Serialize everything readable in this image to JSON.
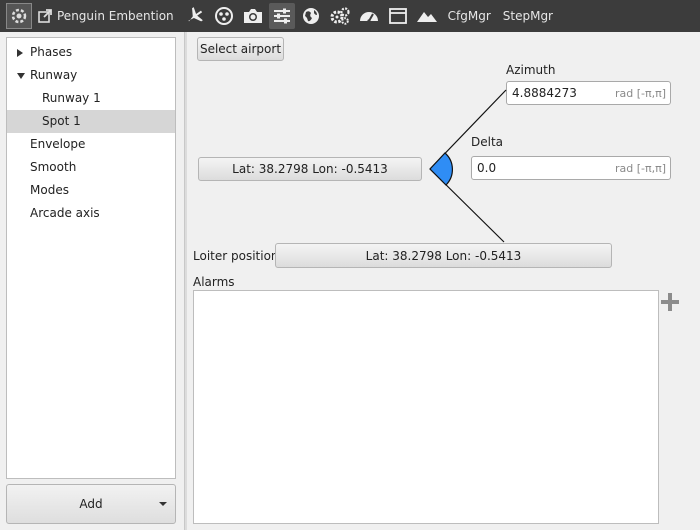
{
  "toolbar": {
    "app_title": "Penguin Embention",
    "cfgmgr_label": "CfgMgr",
    "stepmgr_label": "StepMgr"
  },
  "sidebar": {
    "items": [
      {
        "label": "Phases"
      },
      {
        "label": "Runway"
      },
      {
        "label": "Runway 1"
      },
      {
        "label": "Spot 1"
      },
      {
        "label": "Envelope"
      },
      {
        "label": "Smooth"
      },
      {
        "label": "Modes"
      },
      {
        "label": "Arcade axis"
      }
    ],
    "selected": "Spot 1",
    "add_label": "Add"
  },
  "main": {
    "select_airport_label": "Select airport",
    "spot_position": "Lat: 38.2798  Lon: -0.5413",
    "azimuth": {
      "label": "Azimuth",
      "value": "4.8884273",
      "unit": "rad [-π,π]"
    },
    "delta": {
      "label": "Delta",
      "value": "0.0",
      "unit": "rad [-π,π]"
    },
    "loiter": {
      "label": "Loiter position",
      "position": "Lat: 38.2798  Lon: -0.5413"
    },
    "alarms_label": "Alarms"
  },
  "colors": {
    "toolbar_bg": "#3c3c3c",
    "selection": "#d6d6d6",
    "wedge_fill": "#2f8df5"
  }
}
